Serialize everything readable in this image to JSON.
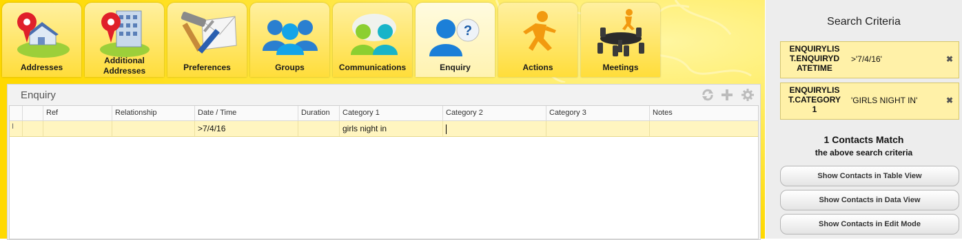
{
  "tabs": [
    {
      "label": "Addresses",
      "icon": "house-pin-icon"
    },
    {
      "label": "Additional\nAddresses",
      "icon": "building-pin-icon"
    },
    {
      "label": "Preferences",
      "icon": "tools-envelope-icon"
    },
    {
      "label": "Groups",
      "icon": "people-group-icon"
    },
    {
      "label": "Communications",
      "icon": "people-chat-icon"
    },
    {
      "label": "Enquiry",
      "icon": "person-question-icon"
    },
    {
      "label": "Actions",
      "icon": "running-man-icon"
    },
    {
      "label": "Meetings",
      "icon": "meeting-table-icon"
    }
  ],
  "active_tab": "Enquiry",
  "panel": {
    "title": "Enquiry",
    "tools": [
      "refresh-icon",
      "add-icon",
      "settings-icon"
    ]
  },
  "grid": {
    "columns": [
      "",
      "Ref",
      "Relationship",
      "Date / Time",
      "Duration",
      "Category 1",
      "Category 2",
      "Category 3",
      "Notes"
    ],
    "rows": [
      [
        "",
        "",
        "",
        ">7/4/16",
        "",
        "girls night in",
        "",
        "",
        ""
      ]
    ]
  },
  "sidebar": {
    "title": "Search Criteria",
    "criteria": [
      {
        "field": "ENQUIRYLIS\nT.ENQUIRYD\nATETIME",
        "value": ">'7/4/16'"
      },
      {
        "field": "ENQUIRYLIS\nT.CATEGORY\n1",
        "value": "'GIRLS NIGHT IN'"
      }
    ],
    "match_count_text": "1 Contacts Match",
    "match_sub_text": "the above search criteria",
    "buttons": [
      "Show Contacts in Table View",
      "Show Contacts in Data View",
      "Show Contacts in Edit Mode"
    ]
  },
  "colors": {
    "tab_bar": "#ffdd00",
    "row_highlight": "#fff5c0",
    "criteria_bg": "#fff1a8"
  }
}
